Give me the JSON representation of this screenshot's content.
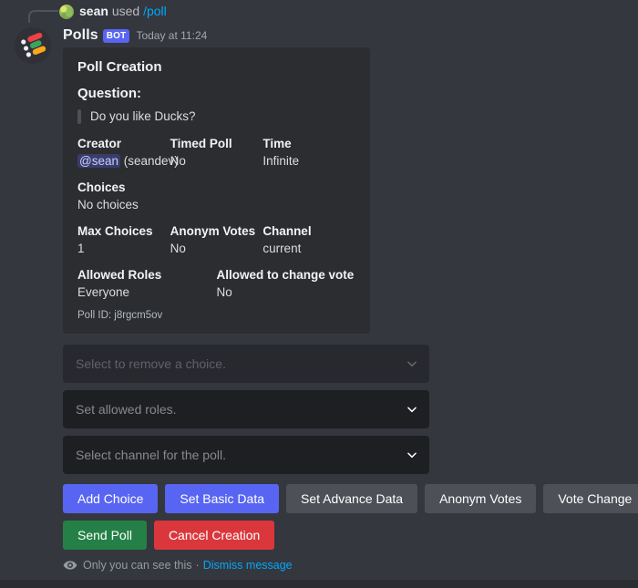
{
  "interaction": {
    "user": "sean",
    "verb": "used",
    "command": "/poll",
    "avatar_icon": "user-avatar"
  },
  "message": {
    "bot_name": "Polls",
    "bot_badge": "BOT",
    "timestamp": "Today at 11:24",
    "avatar_icon": "poll-bars-icon"
  },
  "embed": {
    "title": "Poll Creation",
    "description_label": "Question:",
    "question": "Do you like Ducks?",
    "fields": [
      {
        "name": "Creator",
        "value_mention": "@sean",
        "value_rest": " (seandev)",
        "width": "w3"
      },
      {
        "name": "Timed Poll",
        "value": "No",
        "width": "w3"
      },
      {
        "name": "Time",
        "value": "Infinite",
        "width": "w3"
      },
      {
        "name": "Choices",
        "value": "No choices",
        "width": "w1"
      },
      {
        "name": "Max Choices",
        "value": "1",
        "width": "w3"
      },
      {
        "name": "Anonym Votes",
        "value": "No",
        "width": "w3"
      },
      {
        "name": "Channel",
        "value": "current",
        "width": "w3"
      },
      {
        "name": "Allowed Roles",
        "value": "Everyone",
        "width": "w2"
      },
      {
        "name": "Allowed to change vote",
        "value": "No",
        "width": "w2"
      }
    ],
    "footer": "Poll ID: j8rgcm5ov"
  },
  "selects": [
    {
      "placeholder": "Select to remove a choice.",
      "name": "remove-choice-select",
      "disabled": true
    },
    {
      "placeholder": "Set allowed roles.",
      "name": "allowed-roles-select",
      "disabled": false
    },
    {
      "placeholder": "Select channel for the poll.",
      "name": "channel-select",
      "disabled": false
    }
  ],
  "buttons_row1": [
    {
      "label": "Add Choice",
      "style": "primary",
      "name": "add-choice-button"
    },
    {
      "label": "Set Basic Data",
      "style": "primary",
      "name": "set-basic-data-button"
    },
    {
      "label": "Set Advance Data",
      "style": "secondary",
      "name": "set-advance-data-button"
    },
    {
      "label": "Anonym Votes",
      "style": "secondary",
      "name": "anonym-votes-button"
    },
    {
      "label": "Vote Change",
      "style": "secondary",
      "name": "vote-change-button"
    }
  ],
  "buttons_row2": [
    {
      "label": "Send Poll",
      "style": "success",
      "name": "send-poll-button"
    },
    {
      "label": "Cancel Creation",
      "style": "danger",
      "name": "cancel-creation-button"
    }
  ],
  "ephemeral": {
    "text": "Only you can see this",
    "separator": "·",
    "link": "Dismiss message",
    "icon": "eye-icon"
  },
  "colors": {
    "background": "#35373e",
    "embed_bg": "#2b2d31",
    "select_bg": "#1e1f22",
    "primary": "#5865f2",
    "secondary": "#4e5058",
    "success": "#248046",
    "danger": "#da373c",
    "link": "#00a8fc"
  }
}
